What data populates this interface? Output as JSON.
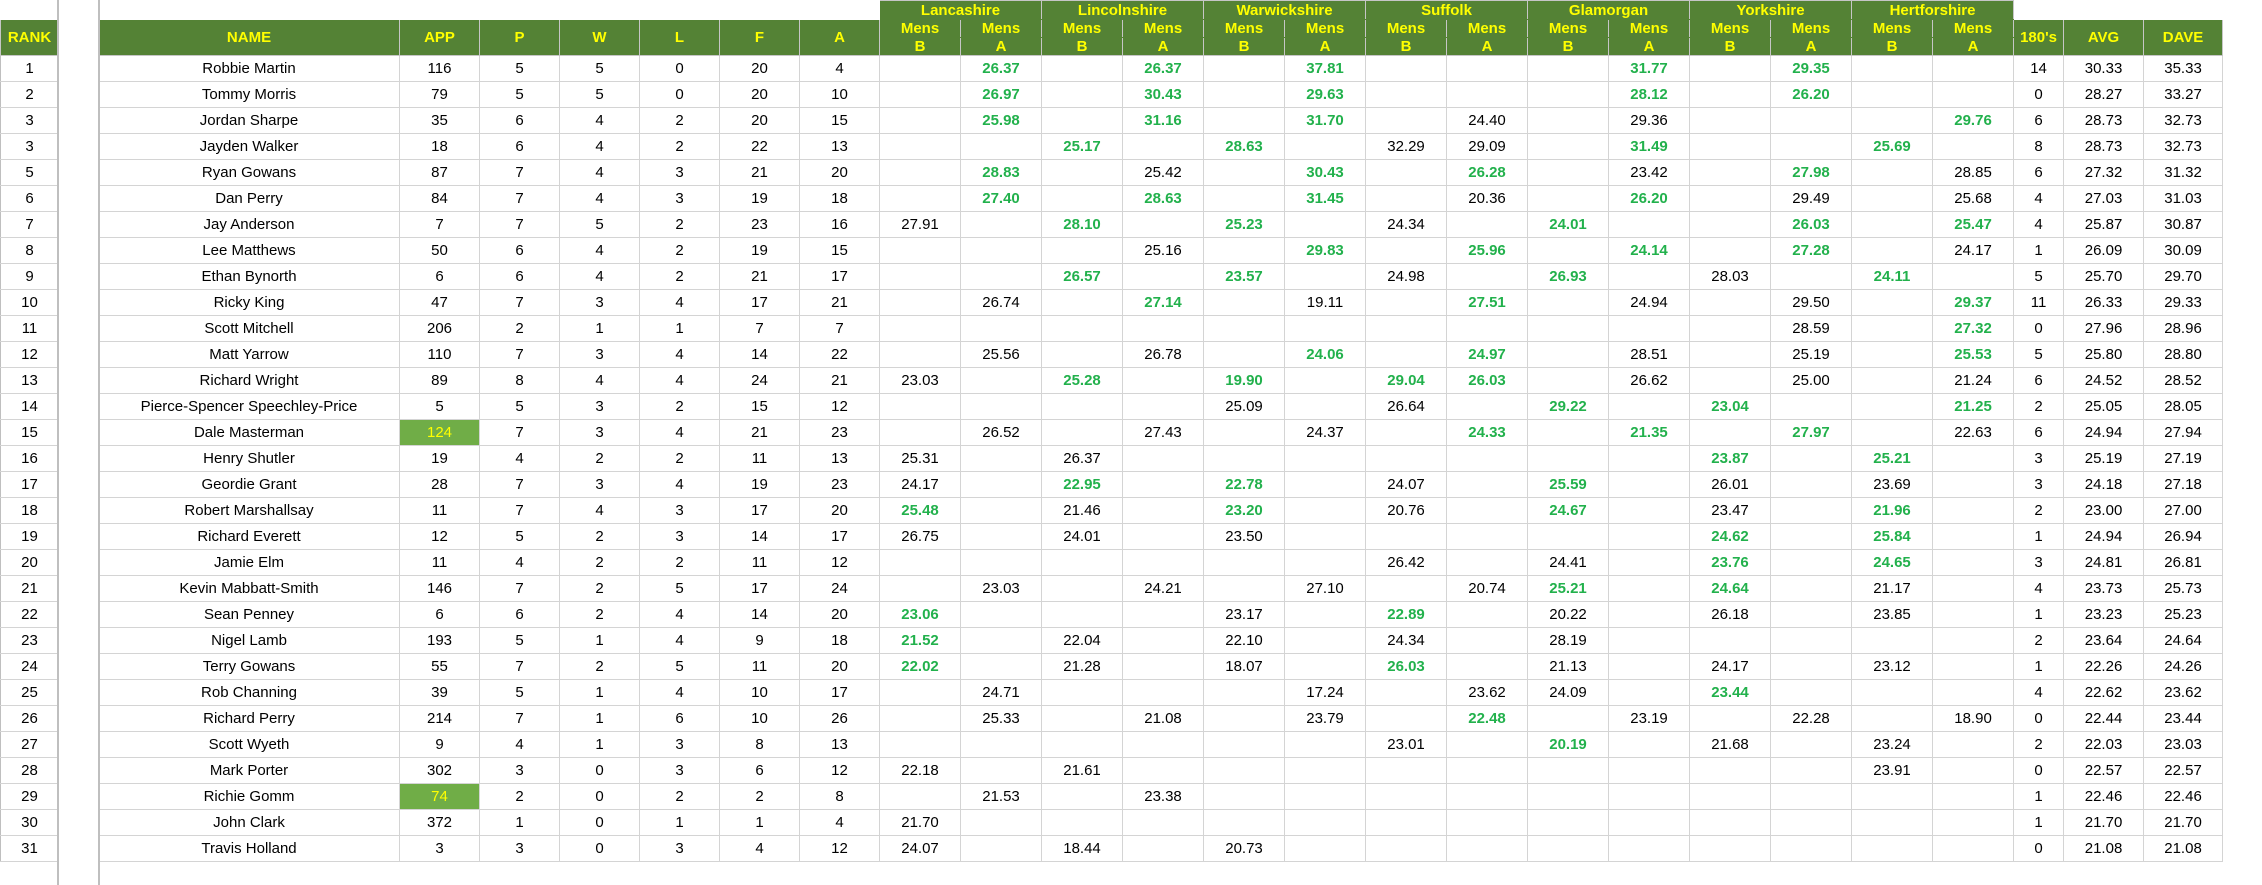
{
  "headers": {
    "rank": "RANK",
    "name": "NAME",
    "app": "APP",
    "p": "P",
    "w": "W",
    "l": "L",
    "f": "F",
    "a": "A",
    "counties": [
      "Lancashire",
      "Lincolnshire",
      "Warwickshire",
      "Suffolk",
      "Glamorgan",
      "Yorkshire",
      "Hertforshire"
    ],
    "mens": "Mens",
    "b": "B",
    "a_sub": "A",
    "one80": "180's",
    "avg": "AVG",
    "dave": "DAVE"
  },
  "colors": {
    "header_bg": "#548235",
    "header_text": "#ffff00",
    "highlight_text": "#22b14c",
    "app_highlight_bg": "#70ad47"
  },
  "rows": [
    {
      "rank": "1",
      "name": "Robbie Martin",
      "app": "116",
      "p": "5",
      "w": "5",
      "l": "0",
      "f": "20",
      "a": "4",
      "c": [
        "",
        "26.37",
        "",
        "26.37",
        "",
        "37.81",
        "",
        "",
        "",
        "31.77",
        "",
        "29.35",
        "",
        ""
      ],
      "one80": "14",
      "avg": "30.33",
      "dave": "35.33"
    },
    {
      "rank": "2",
      "name": "Tommy Morris",
      "app": "79",
      "p": "5",
      "w": "5",
      "l": "0",
      "f": "20",
      "a": "10",
      "c": [
        "",
        "26.97",
        "",
        "30.43",
        "",
        "29.63",
        "",
        "",
        "",
        "28.12",
        "",
        "26.20",
        "",
        ""
      ],
      "one80": "0",
      "avg": "28.27",
      "dave": "33.27"
    },
    {
      "rank": "3",
      "name": "Jordan Sharpe",
      "app": "35",
      "p": "6",
      "w": "4",
      "l": "2",
      "f": "20",
      "a": "15",
      "c": [
        "",
        "25.98",
        "",
        "31.16",
        "",
        "31.70",
        "",
        "24.40",
        "",
        "29.36",
        "",
        "",
        "",
        "29.76"
      ],
      "one80": "6",
      "avg": "28.73",
      "dave": "32.73"
    },
    {
      "rank": "3",
      "name": "Jayden Walker",
      "app": "18",
      "p": "6",
      "w": "4",
      "l": "2",
      "f": "22",
      "a": "13",
      "c": [
        "",
        "",
        "25.17",
        "",
        "28.63",
        "",
        "32.29",
        "29.09",
        "",
        "31.49",
        "",
        "",
        "25.69",
        ""
      ],
      "one80": "8",
      "avg": "28.73",
      "dave": "32.73"
    },
    {
      "rank": "5",
      "name": "Ryan Gowans",
      "app": "87",
      "p": "7",
      "w": "4",
      "l": "3",
      "f": "21",
      "a": "20",
      "c": [
        "",
        "28.83",
        "",
        "25.42",
        "",
        "30.43",
        "",
        "26.28",
        "",
        "23.42",
        "",
        "27.98",
        "",
        "28.85"
      ],
      "one80": "6",
      "avg": "27.32",
      "dave": "31.32"
    },
    {
      "rank": "6",
      "name": "Dan Perry",
      "app": "84",
      "p": "7",
      "w": "4",
      "l": "3",
      "f": "19",
      "a": "18",
      "c": [
        "",
        "27.40",
        "",
        "28.63",
        "",
        "31.45",
        "",
        "20.36",
        "",
        "26.20",
        "",
        "29.49",
        "",
        "25.68"
      ],
      "one80": "4",
      "avg": "27.03",
      "dave": "31.03"
    },
    {
      "rank": "7",
      "name": "Jay Anderson",
      "app": "7",
      "p": "7",
      "w": "5",
      "l": "2",
      "f": "23",
      "a": "16",
      "c": [
        "27.91",
        "",
        "28.10",
        "",
        "25.23",
        "",
        "24.34",
        "",
        "24.01",
        "",
        "",
        "26.03",
        "",
        "25.47"
      ],
      "one80": "4",
      "avg": "25.87",
      "dave": "30.87"
    },
    {
      "rank": "8",
      "name": "Lee Matthews",
      "app": "50",
      "p": "6",
      "w": "4",
      "l": "2",
      "f": "19",
      "a": "15",
      "c": [
        "",
        "",
        "",
        "25.16",
        "",
        "29.83",
        "",
        "25.96",
        "",
        "24.14",
        "",
        "27.28",
        "",
        "24.17"
      ],
      "one80": "1",
      "avg": "26.09",
      "dave": "30.09"
    },
    {
      "rank": "9",
      "name": "Ethan Bynorth",
      "app": "6",
      "p": "6",
      "w": "4",
      "l": "2",
      "f": "21",
      "a": "17",
      "c": [
        "",
        "",
        "26.57",
        "",
        "23.57",
        "",
        "24.98",
        "",
        "26.93",
        "",
        "28.03",
        "",
        "24.11",
        ""
      ],
      "one80": "5",
      "avg": "25.70",
      "dave": "29.70"
    },
    {
      "rank": "10",
      "name": "Ricky King",
      "app": "47",
      "p": "7",
      "w": "3",
      "l": "4",
      "f": "17",
      "a": "21",
      "c": [
        "",
        "26.74",
        "",
        "27.14",
        "",
        "19.11",
        "",
        "27.51",
        "",
        "24.94",
        "",
        "29.50",
        "",
        "29.37"
      ],
      "one80": "11",
      "avg": "26.33",
      "dave": "29.33"
    },
    {
      "rank": "11",
      "name": "Scott Mitchell",
      "app": "206",
      "p": "2",
      "w": "1",
      "l": "1",
      "f": "7",
      "a": "7",
      "c": [
        "",
        "",
        "",
        "",
        "",
        "",
        "",
        "",
        "",
        "",
        "",
        "28.59",
        "",
        "27.32"
      ],
      "one80": "0",
      "avg": "27.96",
      "dave": "28.96"
    },
    {
      "rank": "12",
      "name": "Matt Yarrow",
      "app": "110",
      "p": "7",
      "w": "3",
      "l": "4",
      "f": "14",
      "a": "22",
      "c": [
        "",
        "25.56",
        "",
        "26.78",
        "",
        "24.06",
        "",
        "24.97",
        "",
        "28.51",
        "",
        "25.19",
        "",
        "25.53"
      ],
      "one80": "5",
      "avg": "25.80",
      "dave": "28.80"
    },
    {
      "rank": "13",
      "name": "Richard Wright",
      "app": "89",
      "p": "8",
      "w": "4",
      "l": "4",
      "f": "24",
      "a": "21",
      "c": [
        "23.03",
        "",
        "25.28",
        "",
        "19.90",
        "",
        "29.04",
        "26.03",
        "",
        "26.62",
        "",
        "25.00",
        "",
        "21.24"
      ],
      "one80": "6",
      "avg": "24.52",
      "dave": "28.52"
    },
    {
      "rank": "14",
      "name": "Pierce-Spencer Speechley-Price",
      "app": "5",
      "p": "5",
      "w": "3",
      "l": "2",
      "f": "15",
      "a": "12",
      "c": [
        "",
        "",
        "",
        "",
        "25.09",
        "",
        "26.64",
        "",
        "29.22",
        "",
        "23.04",
        "",
        "",
        "21.25"
      ],
      "one80": "2",
      "avg": "25.05",
      "dave": "28.05"
    },
    {
      "rank": "15",
      "name": "Dale Masterman",
      "app": "124",
      "p": "7",
      "w": "3",
      "l": "4",
      "f": "21",
      "a": "23",
      "c": [
        "",
        "26.52",
        "",
        "27.43",
        "",
        "24.37",
        "",
        "24.33",
        "",
        "21.35",
        "",
        "27.97",
        "",
        "22.63"
      ],
      "one80": "6",
      "avg": "24.94",
      "dave": "27.94"
    },
    {
      "rank": "16",
      "name": "Henry Shutler",
      "app": "19",
      "p": "4",
      "w": "2",
      "l": "2",
      "f": "11",
      "a": "13",
      "c": [
        "25.31",
        "",
        "26.37",
        "",
        "",
        "",
        "",
        "",
        "",
        "",
        "23.87",
        "",
        "25.21",
        ""
      ],
      "one80": "3",
      "avg": "25.19",
      "dave": "27.19"
    },
    {
      "rank": "17",
      "name": "Geordie Grant",
      "app": "28",
      "p": "7",
      "w": "3",
      "l": "4",
      "f": "19",
      "a": "23",
      "c": [
        "24.17",
        "",
        "22.95",
        "",
        "22.78",
        "",
        "24.07",
        "",
        "25.59",
        "",
        "26.01",
        "",
        "23.69",
        ""
      ],
      "one80": "3",
      "avg": "24.18",
      "dave": "27.18"
    },
    {
      "rank": "18",
      "name": "Robert Marshallsay",
      "app": "11",
      "p": "7",
      "w": "4",
      "l": "3",
      "f": "17",
      "a": "20",
      "c": [
        "25.48",
        "",
        "21.46",
        "",
        "23.20",
        "",
        "20.76",
        "",
        "24.67",
        "",
        "23.47",
        "",
        "21.96",
        ""
      ],
      "one80": "2",
      "avg": "23.00",
      "dave": "27.00"
    },
    {
      "rank": "19",
      "name": "Richard Everett",
      "app": "12",
      "p": "5",
      "w": "2",
      "l": "3",
      "f": "14",
      "a": "17",
      "c": [
        "26.75",
        "",
        "24.01",
        "",
        "23.50",
        "",
        "",
        "",
        "",
        "",
        "24.62",
        "",
        "25.84",
        ""
      ],
      "one80": "1",
      "avg": "24.94",
      "dave": "26.94"
    },
    {
      "rank": "20",
      "name": "Jamie Elm",
      "app": "11",
      "p": "4",
      "w": "2",
      "l": "2",
      "f": "11",
      "a": "12",
      "c": [
        "",
        "",
        "",
        "",
        "",
        "",
        "26.42",
        "",
        "24.41",
        "",
        "23.76",
        "",
        "24.65",
        ""
      ],
      "one80": "3",
      "avg": "24.81",
      "dave": "26.81"
    },
    {
      "rank": "21",
      "name": "Kevin Mabbatt-Smith",
      "app": "146",
      "p": "7",
      "w": "2",
      "l": "5",
      "f": "17",
      "a": "24",
      "c": [
        "",
        "23.03",
        "",
        "24.21",
        "",
        "27.10",
        "",
        "20.74",
        "25.21",
        "",
        "24.64",
        "",
        "21.17",
        ""
      ],
      "one80": "4",
      "avg": "23.73",
      "dave": "25.73"
    },
    {
      "rank": "22",
      "name": "Sean Penney",
      "app": "6",
      "p": "6",
      "w": "2",
      "l": "4",
      "f": "14",
      "a": "20",
      "c": [
        "23.06",
        "",
        "",
        "",
        "23.17",
        "",
        "22.89",
        "",
        "20.22",
        "",
        "26.18",
        "",
        "23.85",
        ""
      ],
      "one80": "1",
      "avg": "23.23",
      "dave": "25.23"
    },
    {
      "rank": "23",
      "name": "Nigel Lamb",
      "app": "193",
      "p": "5",
      "w": "1",
      "l": "4",
      "f": "9",
      "a": "18",
      "c": [
        "21.52",
        "",
        "22.04",
        "",
        "22.10",
        "",
        "24.34",
        "",
        "28.19",
        "",
        "",
        "",
        "",
        ""
      ],
      "one80": "2",
      "avg": "23.64",
      "dave": "24.64"
    },
    {
      "rank": "24",
      "name": "Terry Gowans",
      "app": "55",
      "p": "7",
      "w": "2",
      "l": "5",
      "f": "11",
      "a": "20",
      "c": [
        "22.02",
        "",
        "21.28",
        "",
        "18.07",
        "",
        "26.03",
        "",
        "21.13",
        "",
        "24.17",
        "",
        "23.12",
        ""
      ],
      "one80": "1",
      "avg": "22.26",
      "dave": "24.26"
    },
    {
      "rank": "25",
      "name": "Rob Channing",
      "app": "39",
      "p": "5",
      "w": "1",
      "l": "4",
      "f": "10",
      "a": "17",
      "c": [
        "",
        "24.71",
        "",
        "",
        "",
        "17.24",
        "",
        "23.62",
        "24.09",
        "",
        "23.44",
        "",
        "",
        ""
      ],
      "one80": "4",
      "avg": "22.62",
      "dave": "23.62"
    },
    {
      "rank": "26",
      "name": "Richard Perry",
      "app": "214",
      "p": "7",
      "w": "1",
      "l": "6",
      "f": "10",
      "a": "26",
      "c": [
        "",
        "25.33",
        "",
        "21.08",
        "",
        "23.79",
        "",
        "22.48",
        "",
        "23.19",
        "",
        "22.28",
        "",
        "18.90"
      ],
      "one80": "0",
      "avg": "22.44",
      "dave": "23.44"
    },
    {
      "rank": "27",
      "name": "Scott Wyeth",
      "app": "9",
      "p": "4",
      "w": "1",
      "l": "3",
      "f": "8",
      "a": "13",
      "c": [
        "",
        "",
        "",
        "",
        "",
        "",
        "23.01",
        "",
        "20.19",
        "",
        "21.68",
        "",
        "23.24",
        ""
      ],
      "one80": "2",
      "avg": "22.03",
      "dave": "23.03"
    },
    {
      "rank": "28",
      "name": "Mark Porter",
      "app": "302",
      "p": "3",
      "w": "0",
      "l": "3",
      "f": "6",
      "a": "12",
      "c": [
        "22.18",
        "",
        "21.61",
        "",
        "",
        "",
        "",
        "",
        "",
        "",
        "",
        "",
        "23.91",
        ""
      ],
      "one80": "0",
      "avg": "22.57",
      "dave": "22.57"
    },
    {
      "rank": "29",
      "name": "Richie Gomm",
      "app": "74",
      "p": "2",
      "w": "0",
      "l": "2",
      "f": "2",
      "a": "8",
      "c": [
        "",
        "21.53",
        "",
        "23.38",
        "",
        "",
        "",
        "",
        "",
        "",
        "",
        "",
        "",
        ""
      ],
      "one80": "1",
      "avg": "22.46",
      "dave": "22.46"
    },
    {
      "rank": "30",
      "name": "John Clark",
      "app": "372",
      "p": "1",
      "w": "0",
      "l": "1",
      "f": "1",
      "a": "4",
      "c": [
        "21.70",
        "",
        "",
        "",
        "",
        "",
        "",
        "",
        "",
        "",
        "",
        "",
        "",
        ""
      ],
      "one80": "1",
      "avg": "21.70",
      "dave": "21.70"
    },
    {
      "rank": "31",
      "name": "Travis Holland",
      "app": "3",
      "p": "3",
      "w": "0",
      "l": "3",
      "f": "4",
      "a": "12",
      "c": [
        "24.07",
        "",
        "18.44",
        "",
        "20.73",
        "",
        "",
        "",
        "",
        "",
        "",
        "",
        "",
        ""
      ],
      "one80": "0",
      "avg": "21.08",
      "dave": "21.08"
    }
  ],
  "highlights": [
    [
      1,
      3,
      5,
      9,
      11
    ],
    [
      1,
      3,
      5,
      9,
      11
    ],
    [
      1,
      3,
      5,
      13
    ],
    [
      2,
      4,
      9,
      12
    ],
    [
      1,
      5,
      7,
      11
    ],
    [
      1,
      3,
      5,
      9
    ],
    [
      2,
      4,
      8,
      11,
      13
    ],
    [
      5,
      7,
      9,
      11
    ],
    [
      2,
      4,
      8,
      12
    ],
    [
      3,
      7,
      13
    ],
    [
      13
    ],
    [
      5,
      7,
      13
    ],
    [
      2,
      4,
      6,
      7
    ],
    [
      8,
      10,
      13
    ],
    [
      7,
      9,
      11
    ],
    [
      10,
      12
    ],
    [
      2,
      4,
      8
    ],
    [
      0,
      4,
      8,
      12
    ],
    [
      10,
      12
    ],
    [
      10,
      12
    ],
    [
      8,
      10
    ],
    [
      0,
      6
    ],
    [
      0
    ],
    [
      0,
      6
    ],
    [
      10
    ],
    [
      7
    ],
    [
      8
    ],
    [],
    [],
    [],
    []
  ],
  "app_highlight_rows": [
    14,
    28
  ]
}
